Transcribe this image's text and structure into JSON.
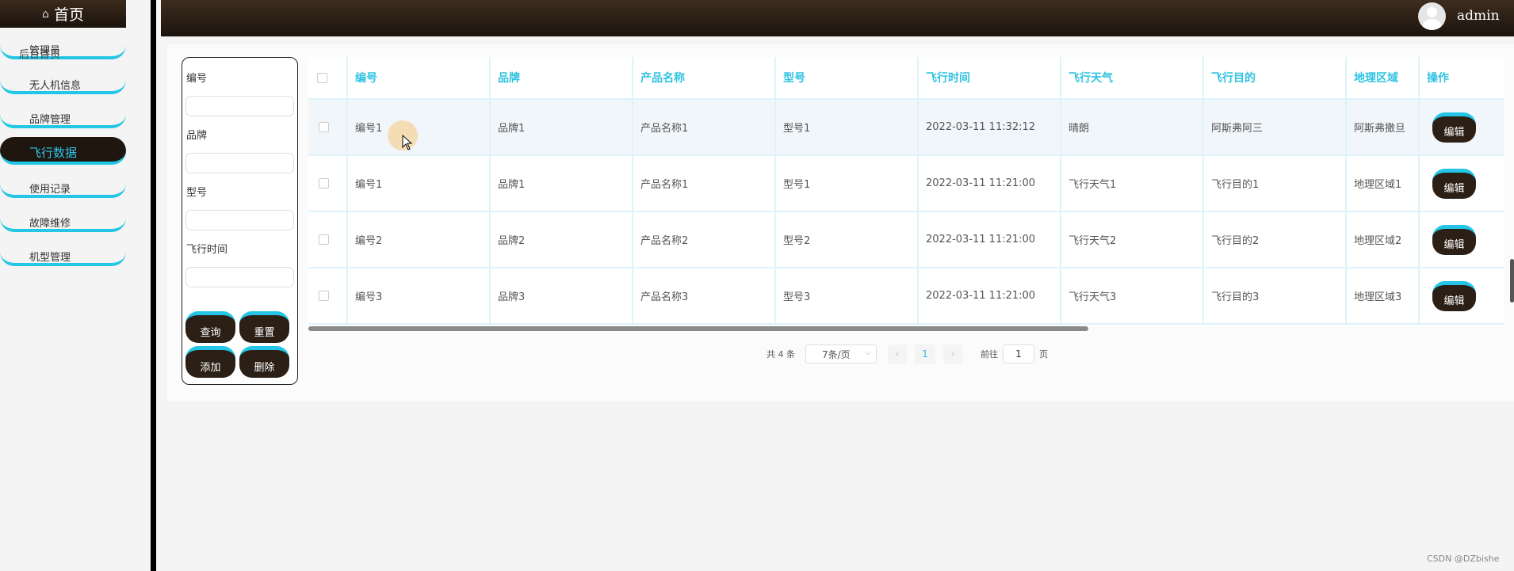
{
  "sidebar": {
    "home": "首页",
    "overlap_text": "后台首页",
    "items": [
      {
        "label": "管理员"
      },
      {
        "label": "无人机信息"
      },
      {
        "label": "品牌管理"
      },
      {
        "label": "飞行数据"
      },
      {
        "label": "使用记录"
      },
      {
        "label": "故障维修"
      },
      {
        "label": "机型管理"
      }
    ],
    "active_index": 3
  },
  "header": {
    "username": "admin"
  },
  "search": {
    "fields": [
      {
        "label": "编号",
        "value": ""
      },
      {
        "label": "品牌",
        "value": ""
      },
      {
        "label": "型号",
        "value": ""
      },
      {
        "label": "飞行时间",
        "value": ""
      }
    ],
    "buttons": {
      "query": "查询",
      "reset": "重置",
      "add": "添加",
      "delete": "删除"
    }
  },
  "table": {
    "columns": [
      "编号",
      "品牌",
      "产品名称",
      "型号",
      "飞行时间",
      "飞行天气",
      "飞行目的",
      "地理区域",
      "操作"
    ],
    "rows": [
      [
        "编号1",
        "品牌1",
        "产品名称1",
        "型号1",
        "2022-03-11 11:32:12",
        "晴朗",
        "阿斯弗阿三",
        "阿斯弗撒旦",
        "编辑"
      ],
      [
        "编号1",
        "品牌1",
        "产品名称1",
        "型号1",
        "2022-03-11 11:21:00",
        "飞行天气1",
        "飞行目的1",
        "地理区域1",
        "编辑"
      ],
      [
        "编号2",
        "品牌2",
        "产品名称2",
        "型号2",
        "2022-03-11 11:21:00",
        "飞行天气2",
        "飞行目的2",
        "地理区域2",
        "编辑"
      ],
      [
        "编号3",
        "品牌3",
        "产品名称3",
        "型号3",
        "2022-03-11 11:21:00",
        "飞行天气3",
        "飞行目的3",
        "地理区域3",
        "编辑"
      ]
    ]
  },
  "pagination": {
    "total": "共 4 条",
    "page_size": "7条/页",
    "prev": "‹",
    "current": "1",
    "next": "›",
    "goto_prefix": "前往",
    "goto_value": "1",
    "goto_suffix": "页"
  },
  "watermark": "CSDN @DZbishe",
  "colors": {
    "accent": "#2fc3e2",
    "dark": "#2c2016"
  }
}
